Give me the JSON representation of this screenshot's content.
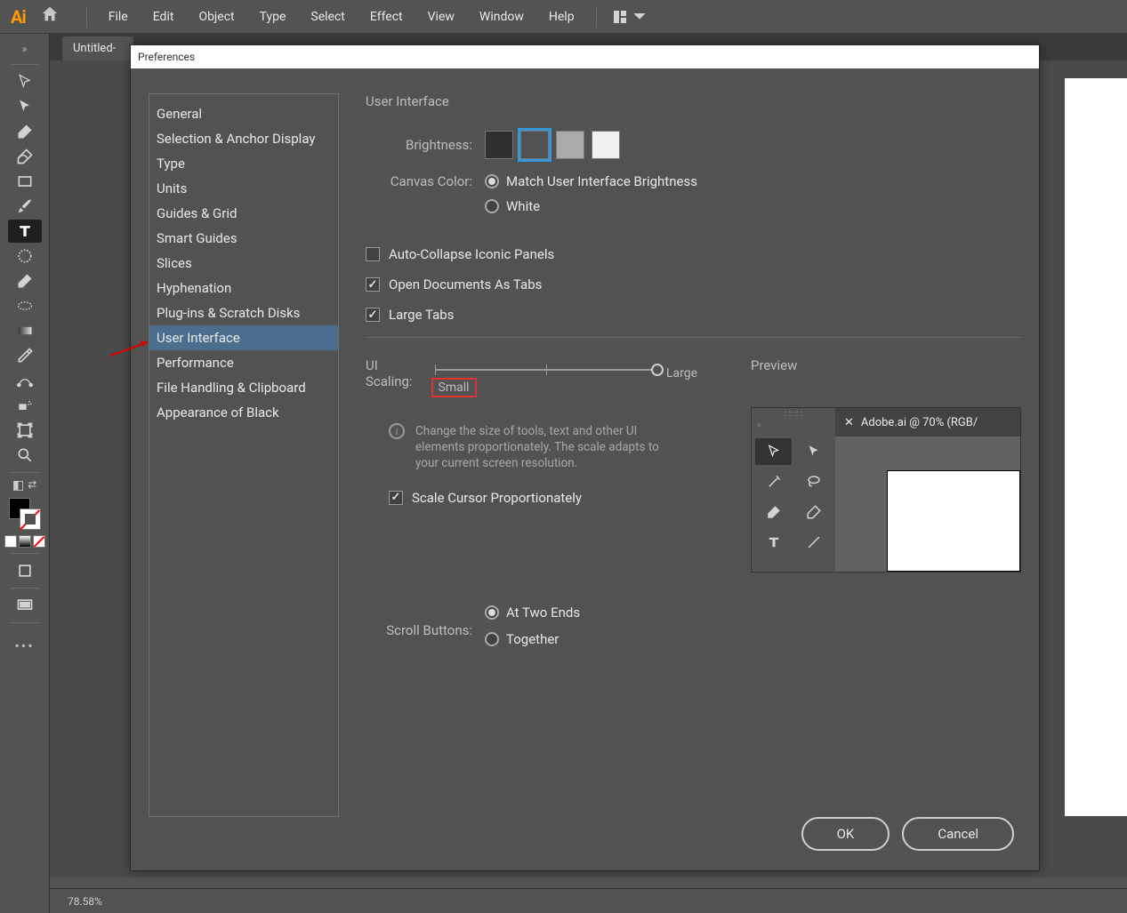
{
  "app": {
    "logo": "Ai"
  },
  "menu": [
    "File",
    "Edit",
    "Object",
    "Type",
    "Select",
    "Effect",
    "View",
    "Window",
    "Help"
  ],
  "document_tab": "Untitled-",
  "status": {
    "zoom": "78.58%"
  },
  "prefs": {
    "title": "Preferences",
    "categories": [
      "General",
      "Selection & Anchor Display",
      "Type",
      "Units",
      "Guides & Grid",
      "Smart Guides",
      "Slices",
      "Hyphenation",
      "Plug-ins & Scratch Disks",
      "User Interface",
      "Performance",
      "File Handling & Clipboard",
      "Appearance of Black"
    ],
    "selected_category": "User Interface",
    "heading": "User Interface",
    "labels": {
      "brightness": "Brightness:",
      "canvas_color": "Canvas Color:",
      "ui_scaling": "UI Scaling:",
      "preview": "Preview",
      "scroll_buttons": "Scroll Buttons:"
    },
    "brightness_swatches": [
      "#303030",
      "#525252",
      "#aaaaaa",
      "#f0f0f0"
    ],
    "brightness_selected": 1,
    "canvas_color": {
      "match": "Match User Interface Brightness",
      "white": "White",
      "selected": "match"
    },
    "checkboxes": {
      "auto_collapse": {
        "label": "Auto-Collapse Iconic Panels",
        "checked": false
      },
      "open_tabs": {
        "label": "Open Documents As Tabs",
        "checked": true
      },
      "large_tabs": {
        "label": "Large Tabs",
        "checked": true
      },
      "scale_cursor": {
        "label": "Scale Cursor Proportionately",
        "checked": true
      }
    },
    "scaling": {
      "small_label": "Small",
      "large_label": "Large",
      "info": "Change the size of tools, text and other UI elements proportionately. The scale adapts to your current screen resolution."
    },
    "preview_tab": "Adobe.ai @ 70% (RGB/",
    "scroll_buttons": {
      "two_ends": "At Two Ends",
      "together": "Together",
      "selected": "two_ends"
    },
    "buttons": {
      "ok": "OK",
      "cancel": "Cancel"
    }
  }
}
